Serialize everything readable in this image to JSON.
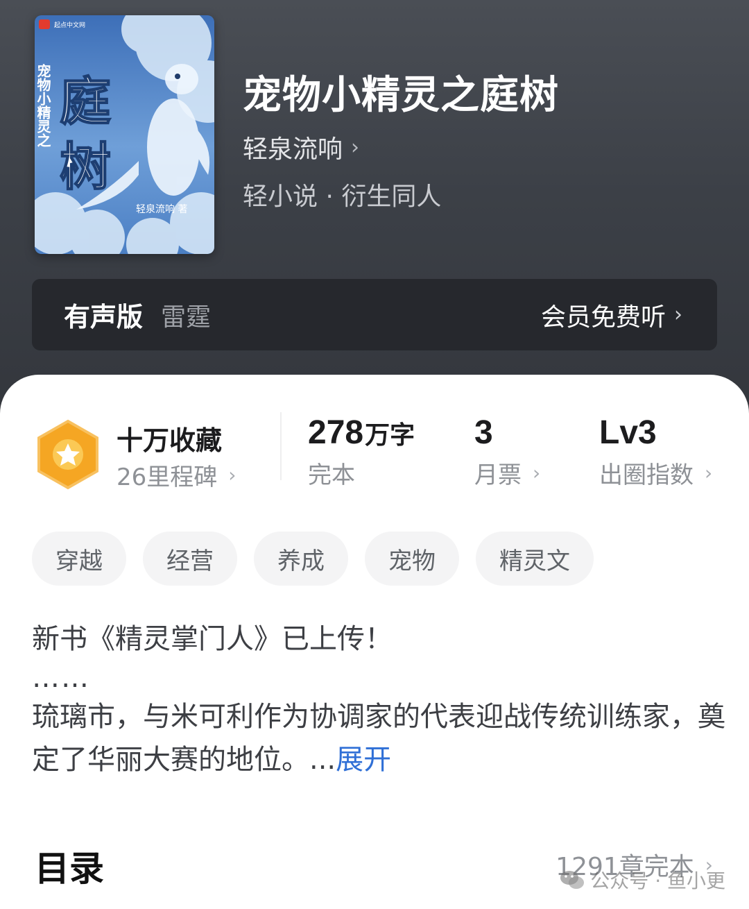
{
  "book": {
    "title": "宠物小精灵之庭树",
    "author": "轻泉流响",
    "genre": "轻小说 · 衍生同人"
  },
  "cover": {
    "publisher_mark": "起点中文网",
    "title_small": "宠物小精灵之",
    "title_large_1": "庭",
    "title_large_2": "树",
    "author_credit": "轻泉流响 著",
    "colors": {
      "sky": "#3e74c0",
      "cloud": "#cfe3f6",
      "accent": "#e23b2e"
    }
  },
  "audio": {
    "label": "有声版",
    "narrator": "雷霆",
    "action": "会员免费听"
  },
  "stats": {
    "collect_title": "十万收藏",
    "collect_sub": "26里程碑",
    "words_num": "278",
    "words_unit": "万字",
    "words_label": "完本",
    "ticket_num": "3",
    "ticket_label": "月票",
    "level_num": "Lv3",
    "level_label": "出圈指数"
  },
  "tags": [
    "穿越",
    "经营",
    "养成",
    "宠物",
    "精灵文"
  ],
  "intro": {
    "line1": "新书《精灵掌门人》已上传！",
    "line2": "……",
    "line3": "琉璃市，与米可利作为协调家的代表迎战传统训练家，奠定了华丽大赛的地位。...",
    "expand": "展开"
  },
  "toc": {
    "title": "目录",
    "count": "1291章完本"
  },
  "watermark": {
    "text": "公众号 · 鱼小更"
  },
  "icons": {
    "chevron": "chevron-right-icon",
    "badge": "star-hexagon-badge-icon",
    "watermark": "wechat-icon"
  },
  "colors": {
    "hero_bg": "#3c4047",
    "link_blue": "#2f6fd6",
    "badge_orange": "#f5a623"
  }
}
